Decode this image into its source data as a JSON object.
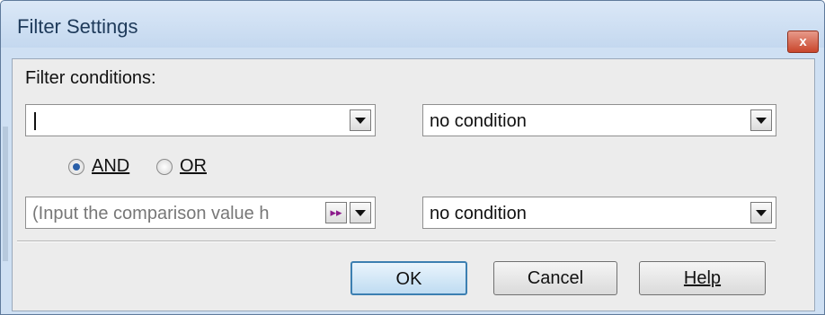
{
  "window": {
    "title": "Filter Settings",
    "close_glyph": "x"
  },
  "filter_conditions_label": "Filter conditions:",
  "row1": {
    "value_text": "",
    "condition_value": "no condition"
  },
  "logic": {
    "and_label": "AND",
    "or_label": "OR",
    "selected": "AND"
  },
  "row2": {
    "value_placeholder": "(Input the comparison value h",
    "condition_value": "no condition",
    "insert_glyph": "▸▸"
  },
  "buttons": {
    "ok": "OK",
    "cancel": "Cancel",
    "help": "Help"
  },
  "icons": {
    "dropdown": "chevron-down-icon",
    "insert": "fast-forward-icon",
    "close": "close-icon"
  }
}
